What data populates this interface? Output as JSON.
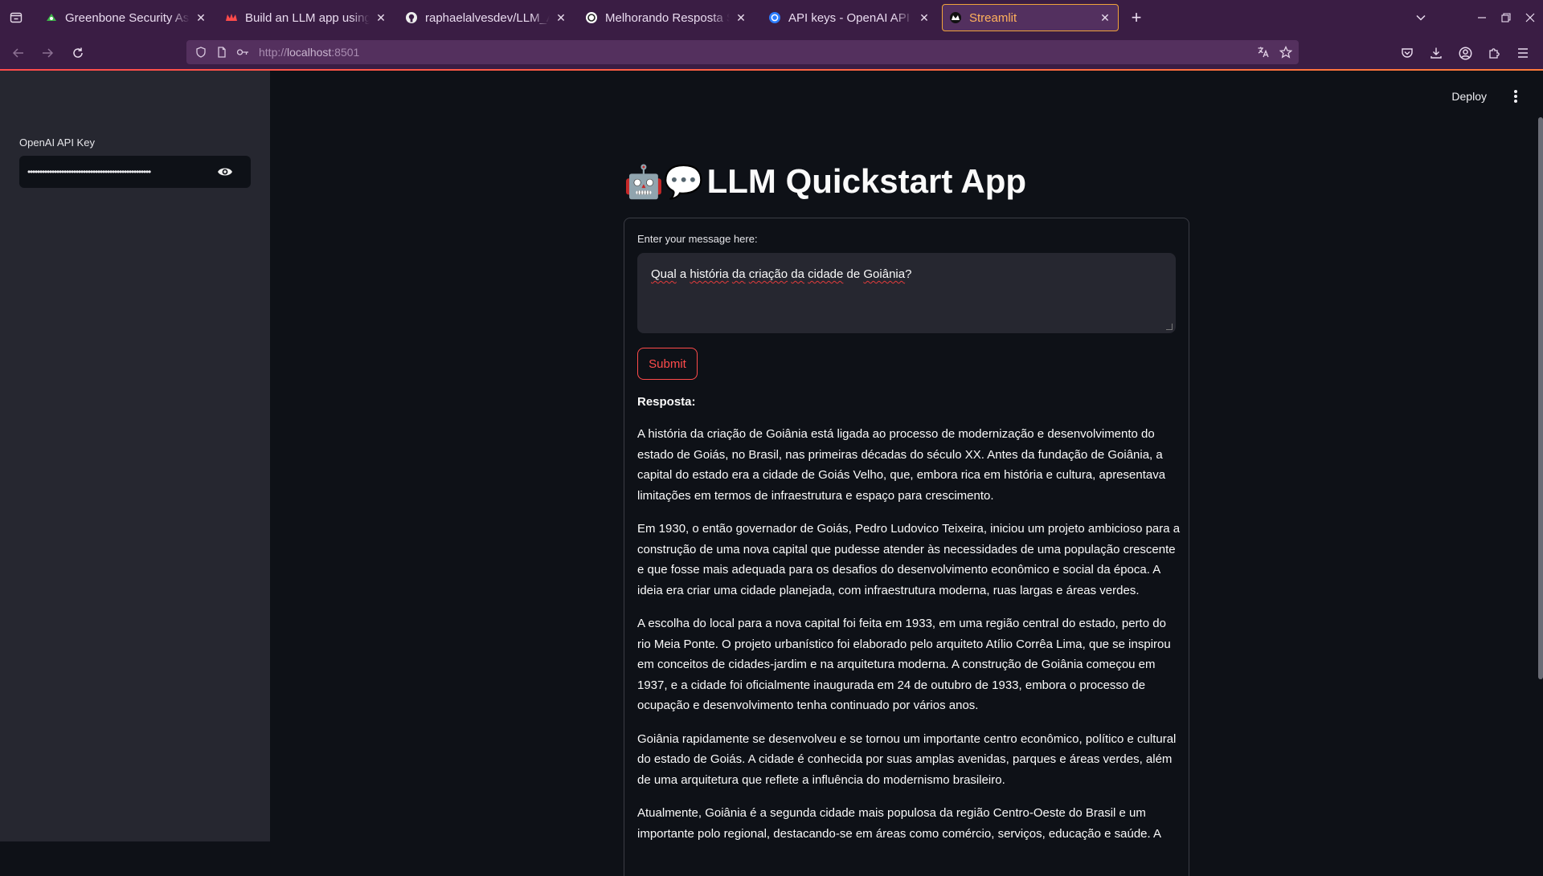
{
  "browser": {
    "tabs": [
      {
        "title": "Greenbone Security Assistant",
        "icon": "greenbone-favicon",
        "active": false
      },
      {
        "title": "Build an LLM app using LangChain",
        "icon": "streamlit-crown-favicon",
        "active": false
      },
      {
        "title": "raphaelalvesdev/LLM_App",
        "icon": "github-favicon",
        "active": false
      },
      {
        "title": "Melhorando Resposta Streamlit",
        "icon": "openai-favicon",
        "active": false
      },
      {
        "title": "API keys - OpenAI API",
        "icon": "openai-blue-favicon",
        "active": false
      },
      {
        "title": "Streamlit",
        "icon": "streamlit-favicon",
        "active": true
      }
    ],
    "url_scheme": "http://",
    "url_host": "localhost",
    "url_port": ":8501"
  },
  "sidebar": {
    "api_key_label": "OpenAI API Key",
    "api_key_masked": "•••••••••••••••••••••••••••••••••••••••••••••••••••"
  },
  "header": {
    "deploy_label": "Deploy"
  },
  "main": {
    "title_emoji": "🤖💬",
    "title": "LLM Quickstart App",
    "input_label": "Enter your message here:",
    "input_words": [
      "Qual",
      "a",
      "história",
      "da",
      "criação",
      "da",
      "cidade",
      "de",
      "Goiânia",
      "?"
    ],
    "submit_label": "Submit",
    "response_label": "Resposta:",
    "response_paragraphs": [
      "A história da criação de Goiânia está ligada ao processo de modernização e desenvolvimento do estado de Goiás, no Brasil, nas primeiras décadas do século XX. Antes da fundação de Goiânia, a capital do estado era a cidade de Goiás Velho, que, embora rica em história e cultura, apresentava limitações em termos de infraestrutura e espaço para crescimento.",
      "Em 1930, o então governador de Goiás, Pedro Ludovico Teixeira, iniciou um projeto ambicioso para a construção de uma nova capital que pudesse atender às necessidades de uma população crescente e que fosse mais adequada para os desafios do desenvolvimento econômico e social da época. A ideia era criar uma cidade planejada, com infraestrutura moderna, ruas largas e áreas verdes.",
      "A escolha do local para a nova capital foi feita em 1933, em uma região central do estado, perto do rio Meia Ponte. O projeto urbanístico foi elaborado pelo arquiteto Atílio Corrêa Lima, que se inspirou em conceitos de cidades-jardim e na arquitetura moderna. A construção de Goiânia começou em 1937, e a cidade foi oficialmente inaugurada em 24 de outubro de 1933, embora o processo de ocupação e desenvolvimento tenha continuado por vários anos.",
      "Goiânia rapidamente se desenvolveu e se tornou um importante centro econômico, político e cultural do estado de Goiás. A cidade é conhecida por suas amplas avenidas, parques e áreas verdes, além de uma arquitetura que reflete a influência do modernismo brasileiro.",
      "Atualmente, Goiânia é a segunda cidade mais populosa da região Centro-Oeste do Brasil e um importante polo regional, destacando-se em áreas como comércio, serviços, educação e saúde. A"
    ]
  },
  "colors": {
    "browser_chrome": "#3a1d44",
    "accent": "#ff4b4b",
    "sidebar_bg": "#262730",
    "app_bg": "#0e1117"
  }
}
